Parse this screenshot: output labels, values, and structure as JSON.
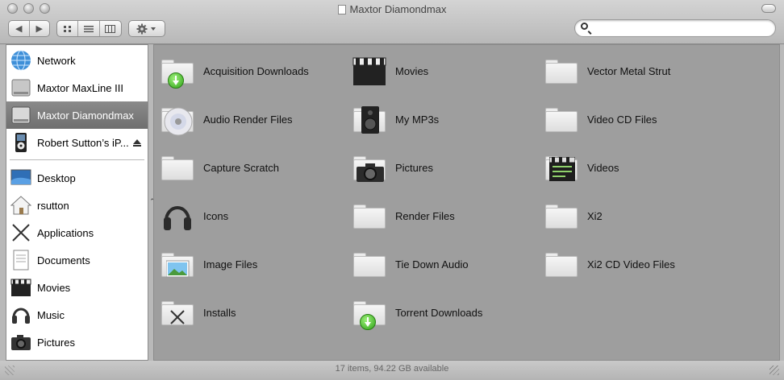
{
  "window": {
    "title": "Maxtor Diamondmax"
  },
  "search": {
    "placeholder": "",
    "value": ""
  },
  "sidebar": {
    "devices": [
      {
        "label": "Network",
        "icon": "globe-icon"
      },
      {
        "label": "Maxtor MaxLine III",
        "icon": "hard-drive-icon"
      },
      {
        "label": "Maxtor Diamondmax",
        "icon": "hard-drive-icon",
        "selected": true
      },
      {
        "label": "Robert Sutton’s iP...",
        "icon": "ipod-icon",
        "eject": true
      }
    ],
    "places": [
      {
        "label": "Desktop",
        "icon": "desktop-icon"
      },
      {
        "label": "rsutton",
        "icon": "home-icon"
      },
      {
        "label": "Applications",
        "icon": "applications-icon"
      },
      {
        "label": "Documents",
        "icon": "documents-icon"
      },
      {
        "label": "Movies",
        "icon": "clapperboard-icon"
      },
      {
        "label": "Music",
        "icon": "headphones-icon"
      },
      {
        "label": "Pictures",
        "icon": "camera-icon"
      }
    ]
  },
  "items": [
    {
      "label": "Acquisition Downloads",
      "icon": "download-folder-icon"
    },
    {
      "label": "Audio Render Files",
      "icon": "cd-folder-icon"
    },
    {
      "label": "Capture Scratch",
      "icon": "folder-icon"
    },
    {
      "label": "Icons",
      "icon": "headphones-icon"
    },
    {
      "label": "Image Files",
      "icon": "image-folder-icon"
    },
    {
      "label": "Installs",
      "icon": "installs-folder-icon"
    },
    {
      "label": "Movies",
      "icon": "clapperboard-icon"
    },
    {
      "label": "My MP3s",
      "icon": "speaker-icon"
    },
    {
      "label": "Pictures",
      "icon": "camera-folder-icon"
    },
    {
      "label": "Render Files",
      "icon": "folder-icon"
    },
    {
      "label": "Tie Down Audio",
      "icon": "folder-icon"
    },
    {
      "label": "Torrent Downloads",
      "icon": "download-folder-icon"
    },
    {
      "label": "Vector Metal Strut",
      "icon": "folder-icon"
    },
    {
      "label": "Video CD Files",
      "icon": "folder-icon"
    },
    {
      "label": "Videos",
      "icon": "movie-take-icon"
    },
    {
      "label": "Xi2",
      "icon": "folder-icon"
    },
    {
      "label": "Xi2 CD Video Files",
      "icon": "folder-icon"
    }
  ],
  "status": {
    "text": "17 items, 94.22 GB available"
  },
  "colors": {
    "selection": "#7a7a7a",
    "content_bg": "#9e9e9e",
    "accent_green": "#2fa318"
  }
}
